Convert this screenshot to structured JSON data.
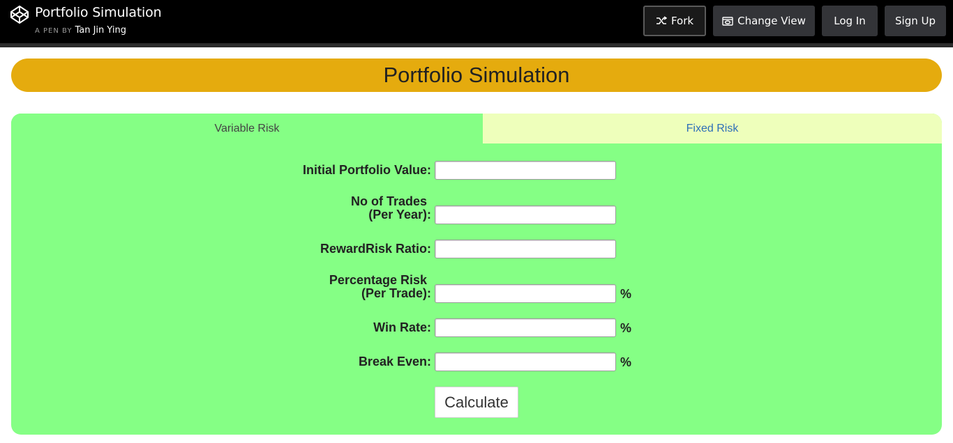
{
  "header": {
    "title": "Portfolio Simulation",
    "by_prefix": "A PEN BY",
    "author": "Tan Jin Ying",
    "buttons": {
      "fork": "Fork",
      "change_view": "Change View",
      "login": "Log In",
      "signup": "Sign Up"
    }
  },
  "page": {
    "banner_title": "Portfolio Simulation"
  },
  "tabs": [
    {
      "label": "Variable Risk",
      "active": true
    },
    {
      "label": "Fixed Risk",
      "active": false
    }
  ],
  "form": {
    "initial_value_label": "Initial Portfolio Value:",
    "trades_label_line1": "No of Trades",
    "trades_label_line2": "(Per Year):",
    "reward_risk_label": "RewardRisk Ratio:",
    "pct_risk_label_line1": "Percentage Risk",
    "pct_risk_label_line2": "(Per Trade):",
    "win_rate_label": "Win Rate:",
    "break_even_label": "Break Even:",
    "percent_symbol": "%",
    "values": {
      "initial_value": "",
      "trades": "",
      "reward_risk": "",
      "pct_risk": "",
      "win_rate": "",
      "break_even": ""
    },
    "calculate_label": "Calculate"
  },
  "colors": {
    "banner": "#e5ab0e",
    "panel": "#85ff85",
    "inactive_tab": "#eeffbb",
    "topbar": "#000000"
  }
}
